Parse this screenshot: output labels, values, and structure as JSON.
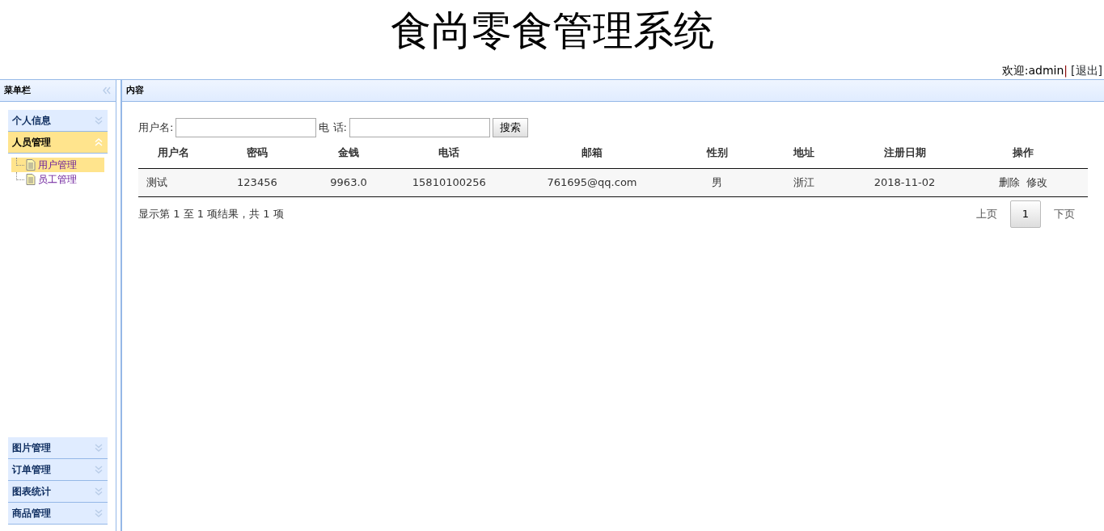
{
  "header": {
    "title": "食尚零食管理系统",
    "welcome": "欢迎:admin",
    "separator": "|",
    "logout": "[退出]"
  },
  "sidebar": {
    "title": "菜单栏",
    "sections": [
      {
        "label": "个人信息",
        "expanded": false
      },
      {
        "label": "人员管理",
        "expanded": true,
        "items": [
          {
            "label": "用户管理",
            "selected": true
          },
          {
            "label": "员工管理",
            "selected": false
          }
        ]
      },
      {
        "label": "图片管理",
        "expanded": false
      },
      {
        "label": "订单管理",
        "expanded": false
      },
      {
        "label": "图表统计",
        "expanded": false
      },
      {
        "label": "商品管理",
        "expanded": false
      }
    ]
  },
  "content": {
    "title": "内容",
    "search": {
      "fields": [
        {
          "label": "用户名:"
        },
        {
          "label": "电 话:"
        }
      ],
      "button": "搜索"
    },
    "table": {
      "columns": [
        "用户名",
        "密码",
        "金钱",
        "电话",
        "邮箱",
        "性别",
        "地址",
        "注册日期",
        "操作"
      ],
      "rows": [
        {
          "cells": [
            "测试",
            "123456",
            "9963.0",
            "15810100256",
            "761695@qq.com",
            "男",
            "浙江",
            "2018-11-02"
          ],
          "actions": [
            "删除",
            "修改"
          ]
        }
      ]
    },
    "summary": "显示第 1 至 1 项结果，共 1 项",
    "pagination": {
      "prev": "上页",
      "pages": [
        {
          "label": "1",
          "selected": true
        }
      ],
      "next": "下页"
    }
  }
}
